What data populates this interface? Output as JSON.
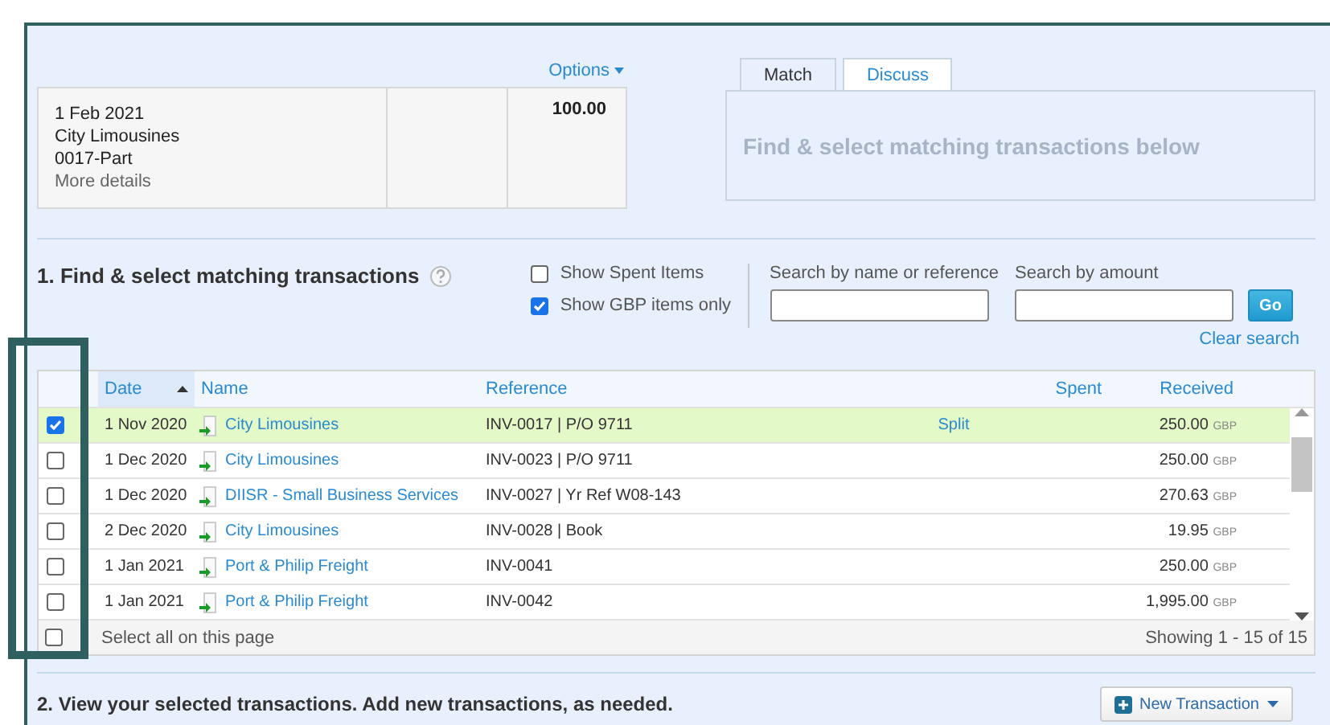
{
  "options": "Options",
  "statement": {
    "date": "1 Feb 2021",
    "payee": "City Limousines",
    "reference": "0017-Part",
    "more": "More details",
    "amount": "100.00"
  },
  "tabs": [
    {
      "label": "Match",
      "selected": true
    },
    {
      "label": "Discuss",
      "selected": false
    }
  ],
  "match_panel": {
    "message": "Find & select matching transactions below"
  },
  "section_1": {
    "title": "1. Find & select matching transactions",
    "filters": [
      {
        "label": "Show Spent Items",
        "checked": false
      },
      {
        "label": "Show GBP items only",
        "checked": true
      }
    ],
    "search_name": {
      "label": "Search by name or reference"
    },
    "search_amount": {
      "label": "Search by amount"
    },
    "go": "Go",
    "clear": "Clear search"
  },
  "table": {
    "columns": [
      {
        "label": "Date",
        "sorted": true
      },
      {
        "label": "Name",
        "sorted": false
      },
      {
        "label": "Reference",
        "sorted": false
      },
      {
        "label": "Spent",
        "sorted": false
      },
      {
        "label": "Received",
        "sorted": false
      }
    ],
    "rows": [
      {
        "date": "1 Nov 2020",
        "name": "City Limousines",
        "reference": "INV-0017 | P/O 9711",
        "split": "Split",
        "received": "250.00",
        "currency": "GBP",
        "checked": true,
        "selected": true
      },
      {
        "date": "1 Dec 2020",
        "name": "City Limousines",
        "reference": "INV-0023 | P/O 9711",
        "received": "250.00",
        "currency": "GBP",
        "checked": false,
        "selected": false
      },
      {
        "date": "1 Dec 2020",
        "name": "DIISR - Small Business Services",
        "reference": "INV-0027 | Yr Ref W08-143",
        "received": "270.63",
        "currency": "GBP",
        "checked": false,
        "selected": false
      },
      {
        "date": "2 Dec 2020",
        "name": "City Limousines",
        "reference": "INV-0028 | Book",
        "received": "19.95",
        "currency": "GBP",
        "checked": false,
        "selected": false
      },
      {
        "date": "1 Jan 2021",
        "name": "Port & Philip Freight",
        "reference": "INV-0041",
        "received": "250.00",
        "currency": "GBP",
        "checked": false,
        "selected": false
      },
      {
        "date": "1 Jan 2021",
        "name": "Port & Philip Freight",
        "reference": "INV-0042",
        "received": "1,995.00",
        "currency": "GBP",
        "checked": false,
        "selected": false
      }
    ],
    "select_all": {
      "label": "Select all on this page",
      "checked": false
    },
    "showing": "Showing 1 - 15 of 15"
  },
  "section_2": {
    "title": "2. View your selected transactions. Add new transactions, as needed.",
    "button": "New Transaction"
  }
}
